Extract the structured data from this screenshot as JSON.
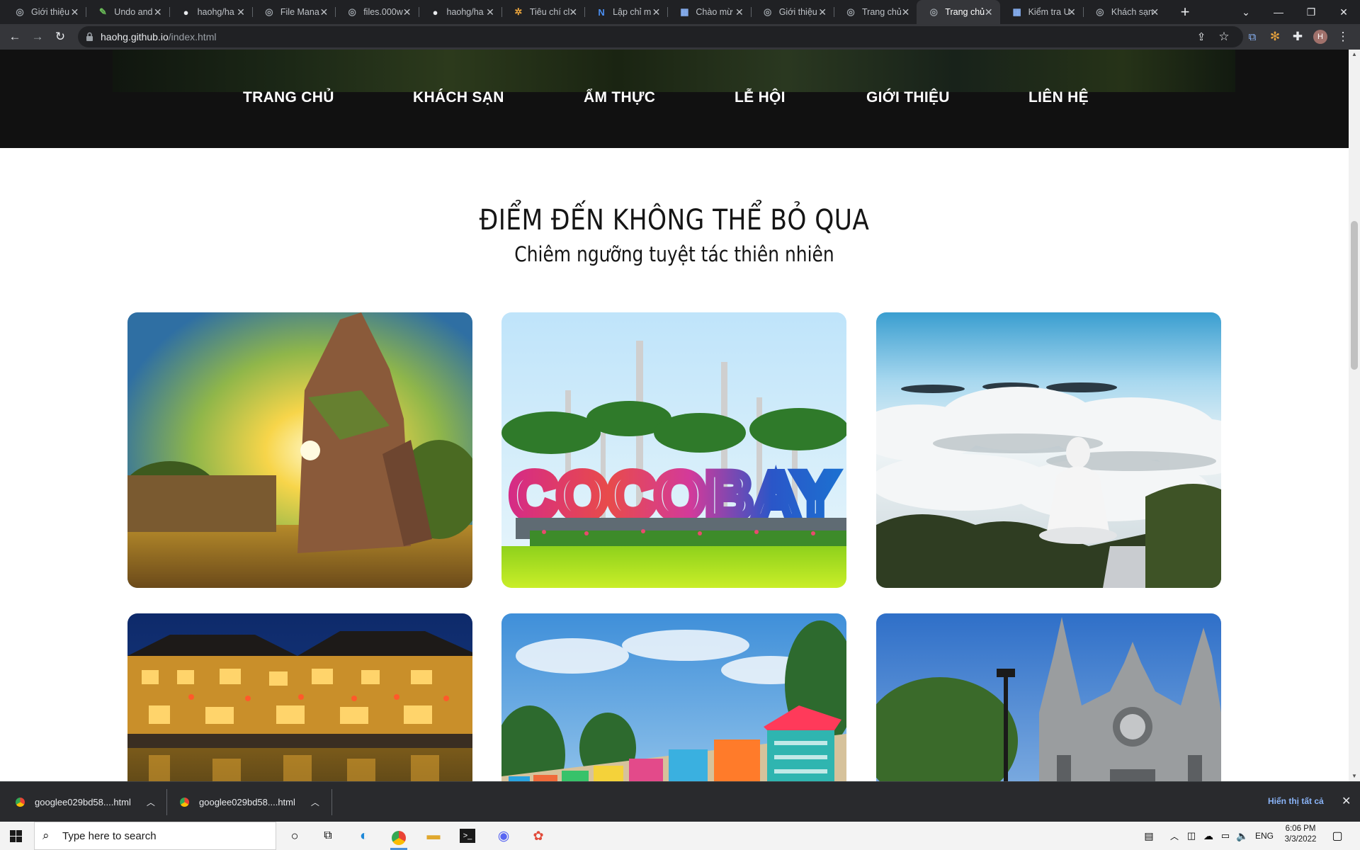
{
  "browser": {
    "tabs": [
      {
        "title": "Giới thiệu",
        "icon": "globe-icon"
      },
      {
        "title": "Undo and",
        "icon": "leaf-icon"
      },
      {
        "title": "haohg/ha",
        "icon": "github-icon"
      },
      {
        "title": "File Mana",
        "icon": "globe-icon"
      },
      {
        "title": "files.000w",
        "icon": "globe-icon"
      },
      {
        "title": "haohg/ha",
        "icon": "github-icon"
      },
      {
        "title": "Tiêu chí cl",
        "icon": "seal-icon"
      },
      {
        "title": "Lập chỉ m",
        "icon": "n-logo-icon"
      },
      {
        "title": "Chào mừ",
        "icon": "store-icon"
      },
      {
        "title": "Giới thiệu",
        "icon": "globe-icon"
      },
      {
        "title": "Trang chủ",
        "icon": "globe-icon"
      },
      {
        "title": "Trang chủ",
        "icon": "globe-icon",
        "active": true
      },
      {
        "title": "Kiểm tra U",
        "icon": "store-icon"
      },
      {
        "title": "Khách sạn",
        "icon": "globe-icon"
      }
    ],
    "url_host": "haohg.github.io",
    "url_path": "/index.html",
    "profile_initial": "H"
  },
  "page": {
    "nav": [
      "TRANG CHỦ",
      "KHÁCH SẠN",
      "ẨM THỰC",
      "LỄ HỘI",
      "GIỚI THIỆU",
      "LIÊN HỆ"
    ],
    "section_title": "ĐIỂM ĐẾN KHÔNG THỂ BỎ QUA",
    "section_subtitle": "Chiêm ngưỡng tuyệt tác thiên nhiên",
    "cards": [
      {
        "label": "My Son sanctuary temple"
      },
      {
        "label": "Cocobay sign"
      },
      {
        "label": "Buddha statue above clouds"
      },
      {
        "label": "Hoi An old town at night"
      },
      {
        "label": "Colorful beach huts"
      },
      {
        "label": "Gothic cathedral"
      }
    ],
    "cocobay_text": "COCOBAY"
  },
  "downloads": {
    "items": [
      "googlee029bd58....html",
      "googlee029bd58....html"
    ],
    "show_all": "Hiển thị tất cả"
  },
  "taskbar": {
    "search_placeholder": "Type here to search",
    "lang": "ENG",
    "time": "6:06 PM",
    "date": "3/3/2022"
  }
}
